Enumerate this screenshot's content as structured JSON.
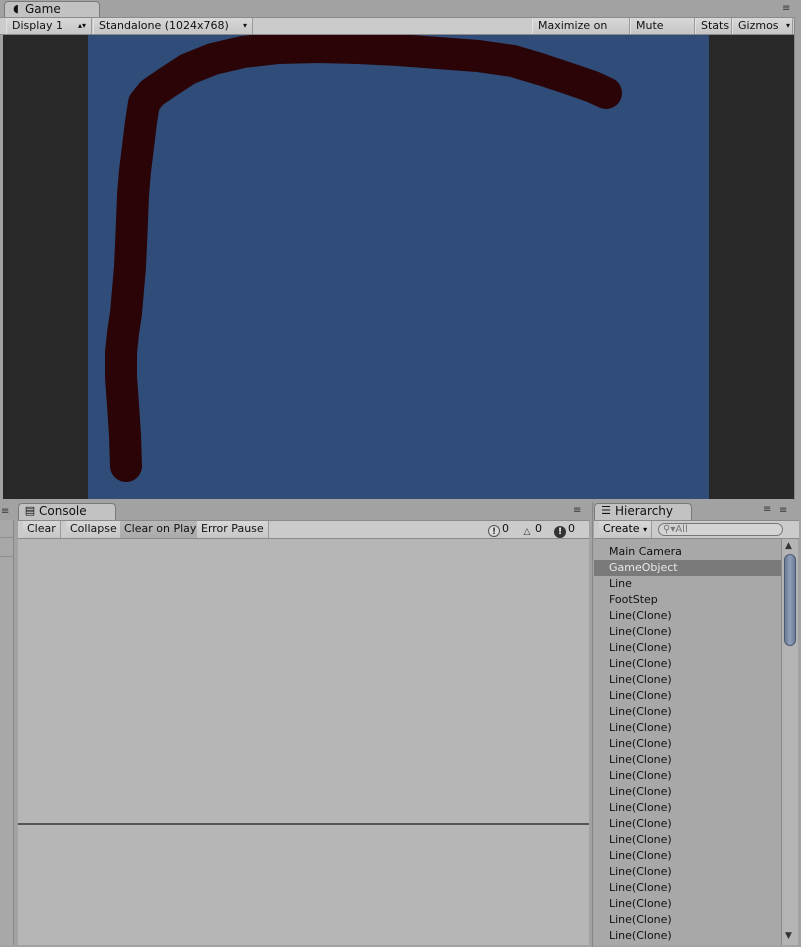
{
  "game": {
    "tab_label": "Game",
    "display_select": "Display 1",
    "aspect_select": "Standalone (1024x768)",
    "maximize_on_play": "Maximize on Play",
    "mute_audio": "Mute audio",
    "stats": "Stats",
    "gizmos": "Gizmos",
    "colors": {
      "background": "#2f4d78",
      "stroke": "#2a0407",
      "letterbox": "#282828"
    }
  },
  "console": {
    "tab_label": "Console",
    "clear": "Clear",
    "collapse": "Collapse",
    "clear_on_play": "Clear on Play",
    "error_pause": "Error Pause",
    "info_count": "0",
    "warning_count": "0",
    "error_count": "0"
  },
  "hierarchy": {
    "tab_label": "Hierarchy",
    "create": "Create",
    "search_placeholder": "All",
    "items": [
      {
        "label": "Main Camera",
        "selected": false
      },
      {
        "label": "GameObject",
        "selected": true
      },
      {
        "label": "Line",
        "selected": false
      },
      {
        "label": "FootStep",
        "selected": false
      },
      {
        "label": "Line(Clone)",
        "selected": false
      },
      {
        "label": "Line(Clone)",
        "selected": false
      },
      {
        "label": "Line(Clone)",
        "selected": false
      },
      {
        "label": "Line(Clone)",
        "selected": false
      },
      {
        "label": "Line(Clone)",
        "selected": false
      },
      {
        "label": "Line(Clone)",
        "selected": false
      },
      {
        "label": "Line(Clone)",
        "selected": false
      },
      {
        "label": "Line(Clone)",
        "selected": false
      },
      {
        "label": "Line(Clone)",
        "selected": false
      },
      {
        "label": "Line(Clone)",
        "selected": false
      },
      {
        "label": "Line(Clone)",
        "selected": false
      },
      {
        "label": "Line(Clone)",
        "selected": false
      },
      {
        "label": "Line(Clone)",
        "selected": false
      },
      {
        "label": "Line(Clone)",
        "selected": false
      },
      {
        "label": "Line(Clone)",
        "selected": false
      },
      {
        "label": "Line(Clone)",
        "selected": false
      },
      {
        "label": "Line(Clone)",
        "selected": false
      },
      {
        "label": "Line(Clone)",
        "selected": false
      },
      {
        "label": "Line(Clone)",
        "selected": false
      },
      {
        "label": "Line(Clone)",
        "selected": false
      },
      {
        "label": "Line(Clone)",
        "selected": false
      }
    ]
  }
}
